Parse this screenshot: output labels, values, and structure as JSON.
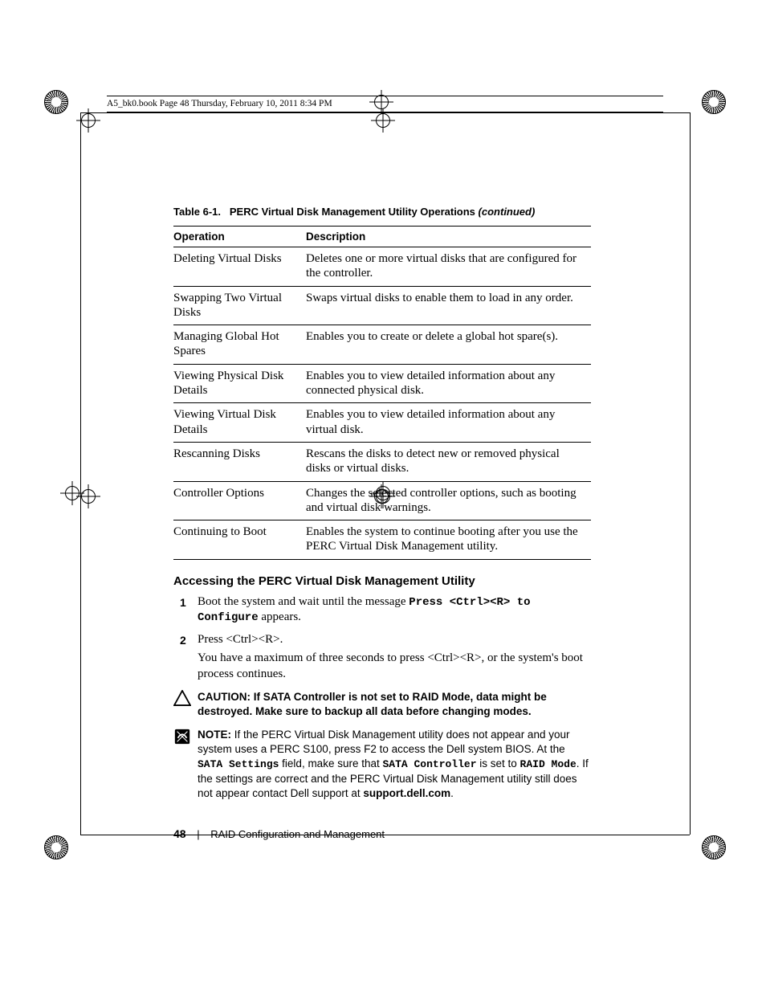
{
  "runningHeader": "A5_bk0.book  Page 48  Thursday, February 10, 2011  8:34 PM",
  "tableCaption": {
    "label": "Table 6-1.",
    "title": "PERC Virtual Disk Management Utility Operations",
    "cont": "(continued)"
  },
  "tableHeaders": {
    "op": "Operation",
    "desc": "Description"
  },
  "rows": [
    {
      "op": "Deleting Virtual Disks",
      "desc": "Deletes one or more virtual disks that are configured for the controller."
    },
    {
      "op": "Swapping Two Virtual Disks",
      "desc": "Swaps virtual disks to enable them to load in any order."
    },
    {
      "op": "Managing Global Hot Spares",
      "desc": "Enables you to create or delete a global hot spare(s)."
    },
    {
      "op": "Viewing Physical Disk Details",
      "desc": "Enables you to view detailed information about any connected physical disk."
    },
    {
      "op": "Viewing Virtual Disk Details",
      "desc": "Enables you to view detailed information about any virtual disk."
    },
    {
      "op": "Rescanning Disks",
      "desc": "Rescans the disks to detect new or removed physical disks or virtual disks."
    },
    {
      "op": "Controller Options",
      "desc": "Changes the selected controller options, such as booting and virtual disk warnings."
    },
    {
      "op": "Continuing to Boot",
      "desc": "Enables the system to continue booting after you use the PERC Virtual Disk Management utility."
    }
  ],
  "sectionHeading": "Accessing the PERC Virtual Disk Management Utility",
  "steps": {
    "s1a": "Boot the system and wait until the message ",
    "s1mono": "Press <Ctrl><R> to Configure",
    "s1b": " appears.",
    "s2a": "Press <Ctrl><R>.",
    "s2b": "You have a maximum of three seconds to press <Ctrl><R>, or the system's boot process continues."
  },
  "caution": {
    "label": "CAUTION: ",
    "text": "If SATA Controller is not set to RAID Mode, data might be destroyed. Make sure to backup all data before changing modes."
  },
  "note": {
    "label": "NOTE: ",
    "t1": "If the PERC Virtual Disk Management utility does not appear and your system uses a PERC S100, press F2 to access the Dell system BIOS. At the ",
    "m1": "SATA Settings",
    "t2": " field, make sure that ",
    "m2": "SATA Controller",
    "t3": " is set to ",
    "m3": "RAID Mode",
    "t4": ". If the settings are correct and the PERC Virtual Disk Management utility still does not appear contact Dell support at ",
    "b1": "support.dell.com",
    "t5": "."
  },
  "footer": {
    "pageNum": "48",
    "section": "RAID Configuration and Management"
  }
}
